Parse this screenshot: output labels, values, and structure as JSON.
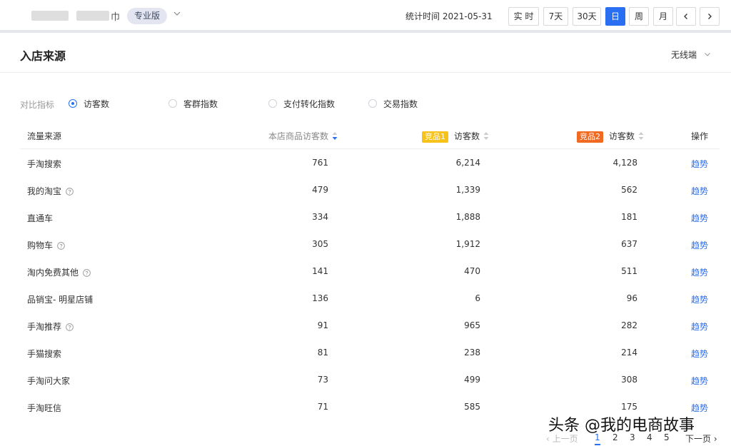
{
  "header": {
    "shop_suffix": "巾",
    "edition": "专业版",
    "stat_time_label": "统计时间",
    "stat_time_value": "2021-05-31",
    "range_buttons": [
      "实 时",
      "7天",
      "30天",
      "日",
      "周",
      "月"
    ],
    "active_range": "日"
  },
  "section": {
    "title": "入店来源",
    "device": "无线端"
  },
  "metrics": {
    "label": "对比指标",
    "options": [
      "访客数",
      "客群指数",
      "支付转化指数",
      "交易指数"
    ],
    "selected": "访客数"
  },
  "table": {
    "columns": {
      "source": "流量来源",
      "own": "本店商品访客数",
      "comp1_badge": "竞品1",
      "comp1": "访客数",
      "comp2_badge": "竞品2",
      "comp2": "访客数",
      "action": "操作"
    },
    "rows": [
      {
        "source": "手淘搜索",
        "help": false,
        "own": "761",
        "comp1": "6,214",
        "comp2": "4,128",
        "action": "趋势"
      },
      {
        "source": "我的淘宝",
        "help": true,
        "own": "479",
        "comp1": "1,339",
        "comp2": "562",
        "action": "趋势"
      },
      {
        "source": "直通车",
        "help": false,
        "own": "334",
        "comp1": "1,888",
        "comp2": "181",
        "action": "趋势"
      },
      {
        "source": "购物车",
        "help": true,
        "own": "305",
        "comp1": "1,912",
        "comp2": "637",
        "action": "趋势"
      },
      {
        "source": "淘内免费其他",
        "help": true,
        "own": "141",
        "comp1": "470",
        "comp2": "511",
        "action": "趋势"
      },
      {
        "source": "品销宝- 明星店铺",
        "help": false,
        "own": "136",
        "comp1": "6",
        "comp2": "96",
        "action": "趋势"
      },
      {
        "source": "手淘推荐",
        "help": true,
        "own": "91",
        "comp1": "965",
        "comp2": "282",
        "action": "趋势"
      },
      {
        "source": "手猫搜索",
        "help": false,
        "own": "81",
        "comp1": "238",
        "comp2": "214",
        "action": "趋势"
      },
      {
        "source": "手淘问大家",
        "help": false,
        "own": "73",
        "comp1": "499",
        "comp2": "308",
        "action": "趋势"
      },
      {
        "source": "手淘旺信",
        "help": false,
        "own": "71",
        "comp1": "585",
        "comp2": "175",
        "action": "趋势"
      }
    ]
  },
  "pagination": {
    "prev": "上一页",
    "pages": [
      "1",
      "2",
      "3",
      "4",
      "5"
    ],
    "current": "1",
    "next": "下一页"
  },
  "watermark": "头条 @我的电商故事",
  "colors": {
    "accent": "#2a6ff2",
    "badge1": "#f7c21a",
    "badge2": "#f06a22"
  }
}
